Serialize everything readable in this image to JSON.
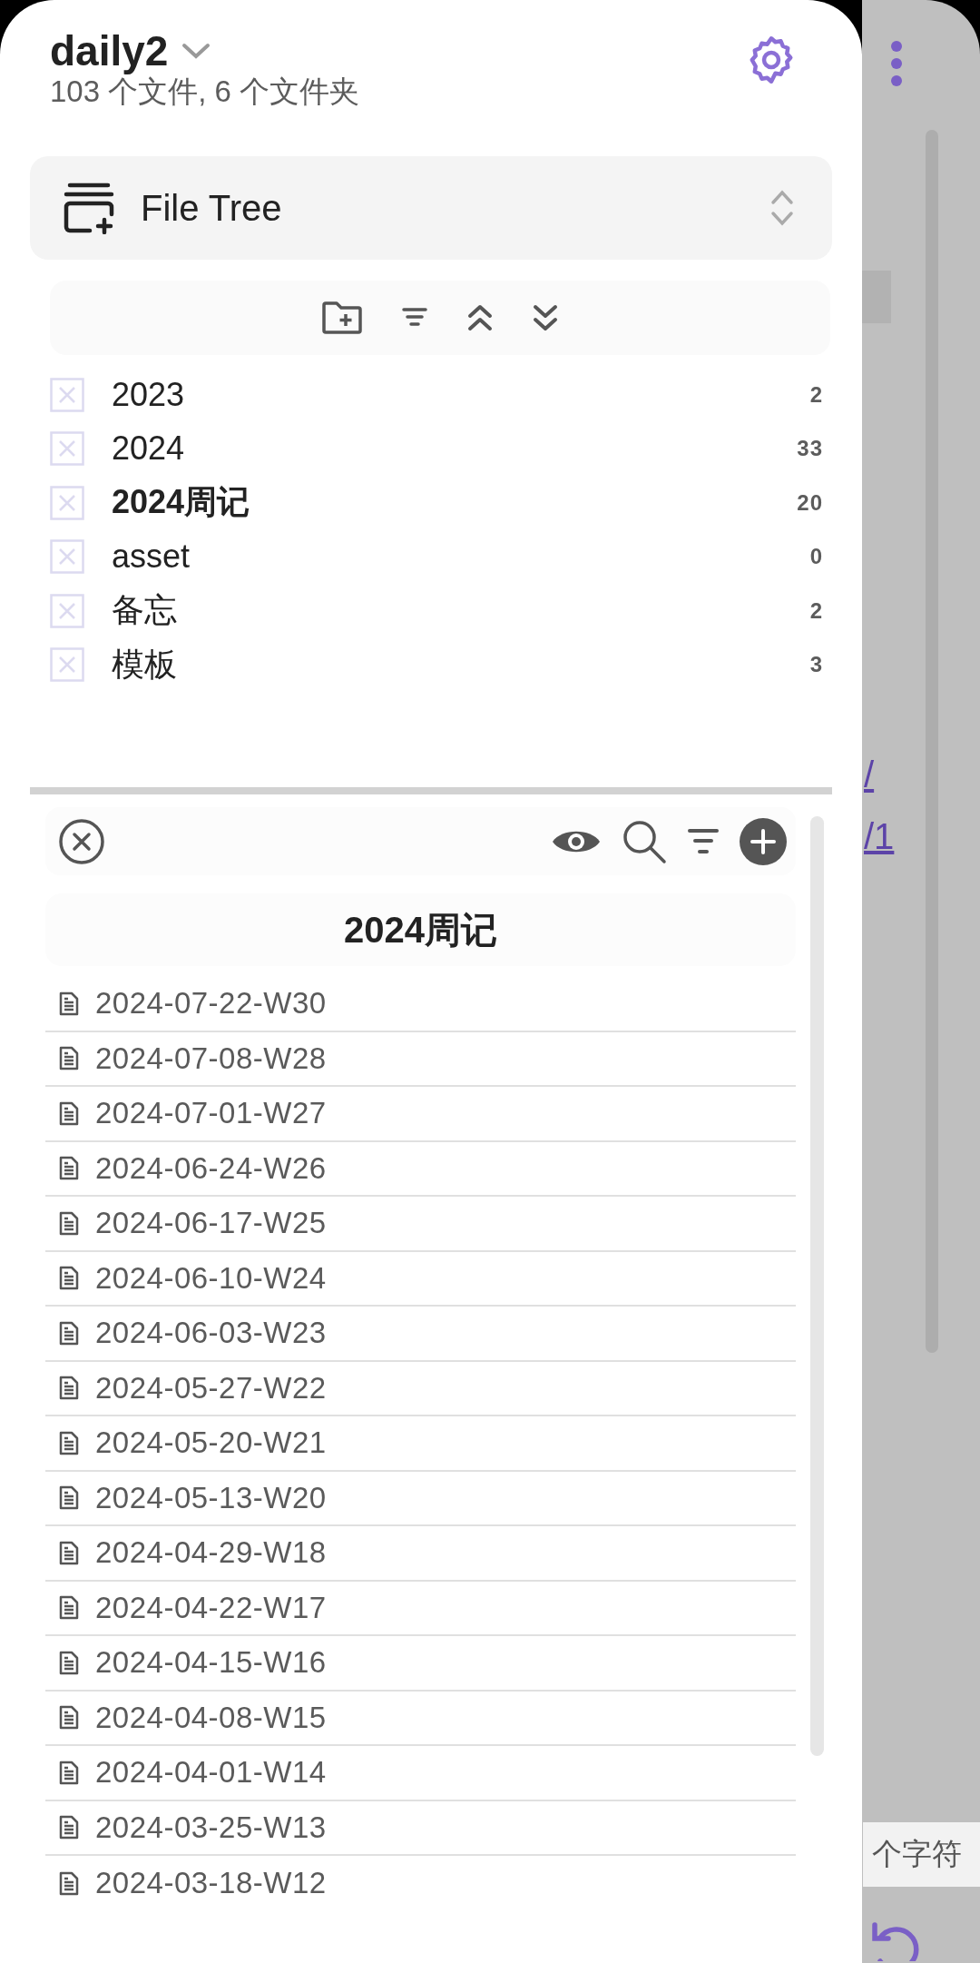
{
  "vault": {
    "name": "daily2",
    "stats": "103 个文件, 6 个文件夹"
  },
  "view_selector": {
    "label": "File Tree"
  },
  "folders": [
    {
      "name": "2023",
      "count": "2",
      "selected": false
    },
    {
      "name": "2024",
      "count": "33",
      "selected": false
    },
    {
      "name": "2024周记",
      "count": "20",
      "selected": true
    },
    {
      "name": "asset",
      "count": "0",
      "selected": false
    },
    {
      "name": "备忘",
      "count": "2",
      "selected": false
    },
    {
      "name": "模板",
      "count": "3",
      "selected": false
    }
  ],
  "file_panel": {
    "title": "2024周记",
    "files": [
      "2024-07-22-W30",
      "2024-07-08-W28",
      "2024-07-01-W27",
      "2024-06-24-W26",
      "2024-06-17-W25",
      "2024-06-10-W24",
      "2024-06-03-W23",
      "2024-05-27-W22",
      "2024-05-20-W21",
      "2024-05-13-W20",
      "2024-04-29-W18",
      "2024-04-22-W17",
      "2024-04-15-W16",
      "2024-04-08-W15",
      "2024-04-01-W14",
      "2024-03-25-W13",
      "2024-03-18-W12"
    ]
  },
  "background": {
    "links": [
      "/",
      "/1"
    ],
    "status": "个字符"
  }
}
